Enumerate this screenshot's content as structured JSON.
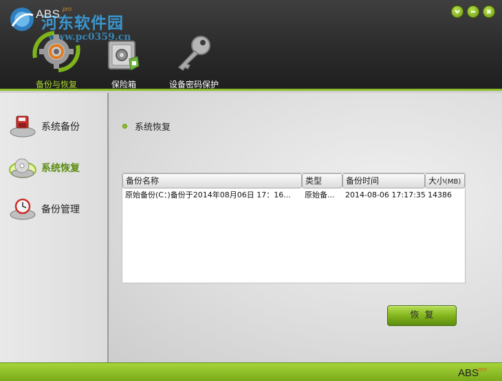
{
  "header": {
    "app_name": "ABS",
    "app_sup": "pro",
    "watermark_text": "河东软件园",
    "watermark_url": "www.pc0359.cn",
    "accent_color": "#8cbf26"
  },
  "window_controls": {
    "icons": [
      "chevron-down-icon",
      "minimize-icon",
      "close-icon"
    ]
  },
  "tabs": [
    {
      "label": "备份与恢复",
      "icon": "gear-refresh-icon",
      "active": true
    },
    {
      "label": "保险箱",
      "icon": "safe-icon",
      "active": false
    },
    {
      "label": "设备密码保护",
      "icon": "key-icon",
      "active": false
    }
  ],
  "sidebar": {
    "items": [
      {
        "label": "系统备份",
        "icon": "floppy-drive-icon",
        "active": false
      },
      {
        "label": "系统恢复",
        "icon": "disc-drive-icon",
        "active": true
      },
      {
        "label": "备份管理",
        "icon": "clock-drive-icon",
        "active": false
      }
    ]
  },
  "main": {
    "section_title": "系统恢复",
    "table": {
      "columns": [
        "备份名称",
        "类型",
        "备份时间",
        "大小"
      ],
      "size_unit": "(MB)",
      "rows": [
        {
          "name": "原始备份(C：)备份于2014年08月06日 17：16...",
          "type": "原始备...",
          "time": "2014-08-06 17:17:35",
          "size": "14386"
        }
      ]
    },
    "restore_button": "恢复"
  },
  "footer": {
    "logo": "ABS",
    "logo_sup": "pro"
  }
}
